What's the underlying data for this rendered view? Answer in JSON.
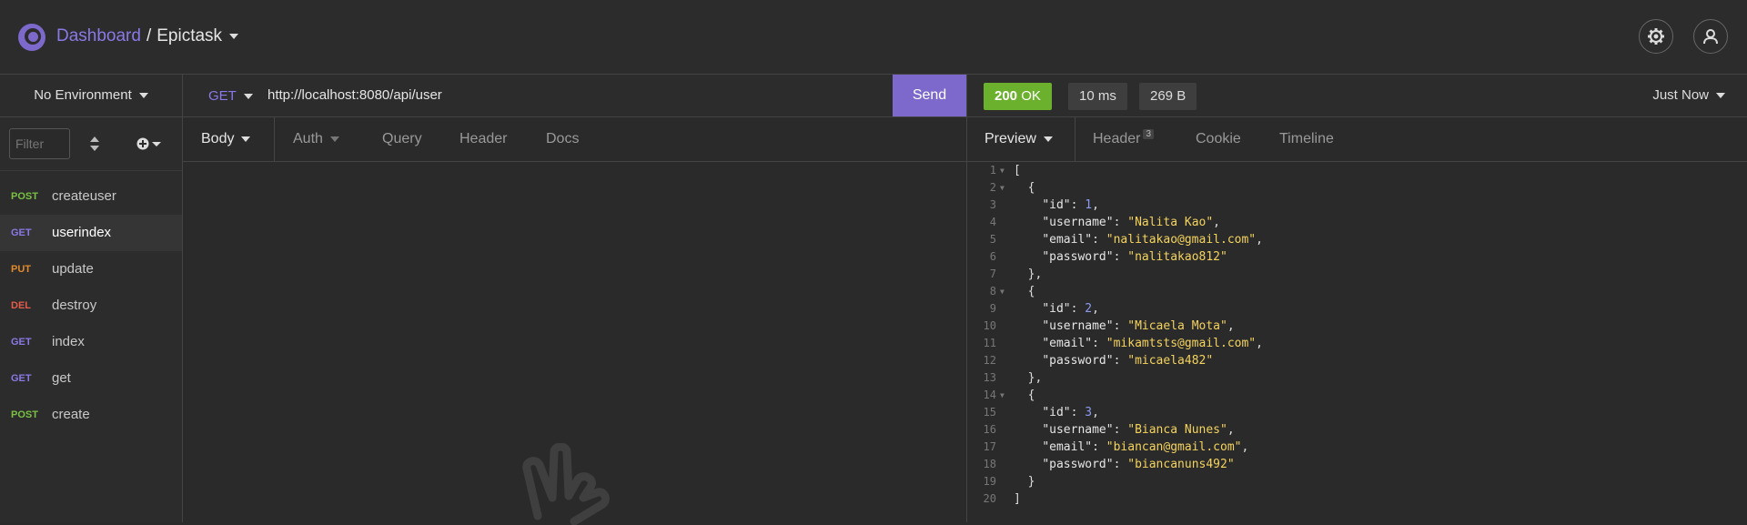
{
  "header": {
    "dashboard_label": "Dashboard",
    "separator": "/",
    "workspace_label": "Epictask"
  },
  "sidebar": {
    "environment_label": "No Environment",
    "filter_placeholder": "Filter",
    "requests": [
      {
        "method": "POST",
        "name": "createuser"
      },
      {
        "method": "GET",
        "name": "userindex"
      },
      {
        "method": "PUT",
        "name": "update"
      },
      {
        "method": "DEL",
        "name": "destroy"
      },
      {
        "method": "GET",
        "name": "index"
      },
      {
        "method": "GET",
        "name": "get"
      },
      {
        "method": "POST",
        "name": "create"
      }
    ]
  },
  "request": {
    "method": "GET",
    "url": "http://localhost:8080/api/user",
    "send_label": "Send",
    "tabs": [
      "Body",
      "Auth",
      "Query",
      "Header",
      "Docs"
    ]
  },
  "response": {
    "status_code": "200",
    "status_text": "OK",
    "time": "10 ms",
    "size": "269 B",
    "history_label": "Just Now",
    "tabs": [
      "Preview",
      "Header",
      "Cookie",
      "Timeline"
    ],
    "header_count": "3",
    "lines": [
      "[",
      "  {",
      "    \"id\": 1,",
      "    \"username\": \"Nalita Kao\",",
      "    \"email\": \"nalitakao@gmail.com\",",
      "    \"password\": \"nalitakao812\"",
      "  },",
      "  {",
      "    \"id\": 2,",
      "    \"username\": \"Micaela Mota\",",
      "    \"email\": \"mikamtsts@gmail.com\",",
      "    \"password\": \"micaela482\"",
      "  },",
      "  {",
      "    \"id\": 3,",
      "    \"username\": \"Bianca Nunes\",",
      "    \"email\": \"biancan@gmail.com\",",
      "    \"password\": \"biancanuns492\"",
      "  }",
      "]"
    ]
  },
  "colors": {
    "accent": "#7d69cb",
    "status_ok": "#6bb12e",
    "method_post": "#7ac143",
    "method_get": "#8b78e6",
    "method_put": "#e08a2c",
    "method_del": "#e25b4b"
  }
}
